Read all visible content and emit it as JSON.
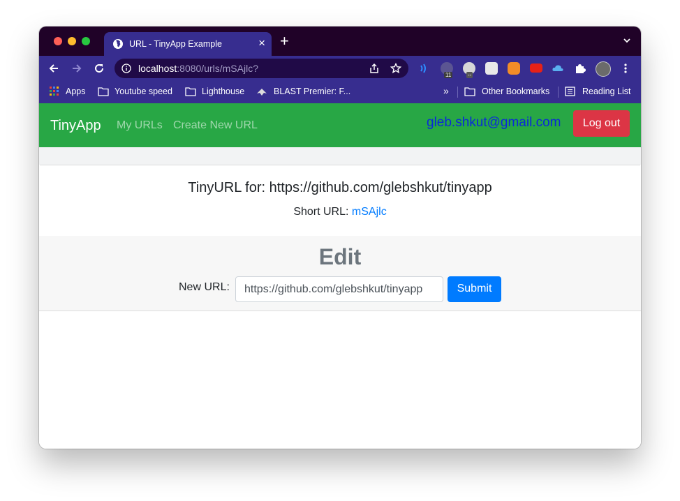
{
  "browser": {
    "tab": {
      "title": "URL - TinyApp Example",
      "close": "×",
      "icon": "globe-icon"
    },
    "new_tab": "+",
    "address": {
      "host": "localhost",
      "rest": ":8080/urls/mSAjlc?"
    },
    "bookmarks": [
      {
        "label": "Apps",
        "icon": "apps-grid-icon"
      },
      {
        "label": "Youtube speed",
        "icon": "folder-icon"
      },
      {
        "label": "Lighthouse",
        "icon": "folder-icon"
      },
      {
        "label": "BLAST Premier: F...",
        "icon": "blast-icon"
      }
    ],
    "bookmarks_overflow": "»",
    "other_bookmarks": "Other Bookmarks",
    "reading_list": "Reading List",
    "extensions": [
      {
        "icon": "wifi-extension-icon"
      },
      {
        "icon": "extension-badge-icon",
        "badge": "11"
      },
      {
        "icon": "extension-gray-icon",
        "badge": "--"
      },
      {
        "icon": "extension-tile-icon"
      },
      {
        "icon": "metamask-icon"
      },
      {
        "icon": "youtube-forward-icon"
      },
      {
        "icon": "cloud-icon"
      },
      {
        "icon": "puzzle-icon"
      },
      {
        "icon": "profile-avatar"
      },
      {
        "icon": "kebab-menu-icon"
      }
    ]
  },
  "app": {
    "brand": "TinyApp",
    "nav": {
      "my_urls": "My URLs",
      "create_new": "Create New URL"
    },
    "user_email": "gleb.shkut@gmail.com",
    "logout": "Log out",
    "card": {
      "title": "TinyURL for: https://github.com/glebshkut/tinyapp",
      "short_label": "Short URL: ",
      "short_value": "mSAjlc"
    },
    "edit": {
      "heading": "Edit",
      "label": "New URL:",
      "value": "https://github.com/glebshkut/tinyapp",
      "submit": "Submit"
    }
  },
  "colors": {
    "navbar": "#28a745",
    "logout": "#dc3545",
    "submit": "#007bff",
    "browser_frame": "#372d8f",
    "tab_strip": "#200228"
  }
}
